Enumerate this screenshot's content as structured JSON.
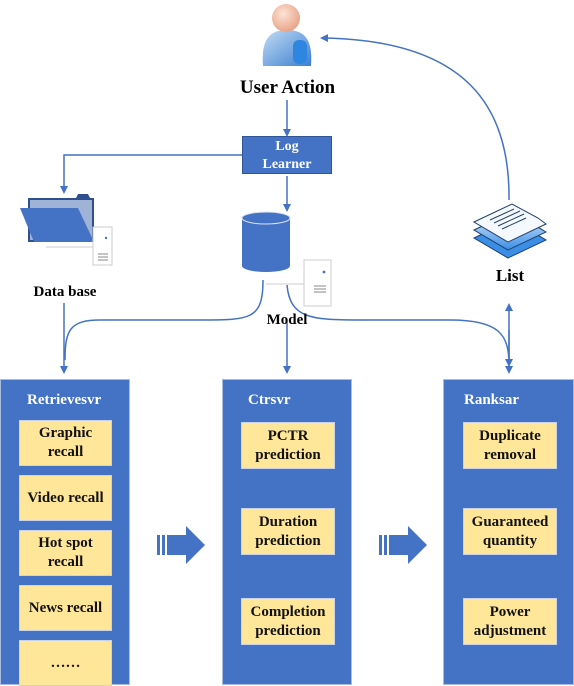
{
  "nodes": {
    "user_action": {
      "label": "User Action",
      "icon": "user-icon"
    },
    "log_learner": {
      "label_line1": "Log",
      "label_line2": "Learner"
    },
    "data_base": {
      "label": "Data base",
      "icon": "folder-icon"
    },
    "model": {
      "label": "Model",
      "icon": "database-cylinder-icon"
    },
    "list": {
      "label": "List",
      "icon": "document-stack-icon"
    }
  },
  "panels": {
    "retrieve": {
      "title": "Retrievesvr",
      "items": [
        "Graphic recall",
        "Video recall",
        "Hot spot recall",
        "News recall",
        "……"
      ]
    },
    "ctr": {
      "title": "Ctrsvr",
      "items": [
        "PCTR prediction",
        "Duration prediction",
        "Completion prediction"
      ]
    },
    "rank": {
      "title": "Ranksar",
      "items": [
        "Duplicate removal",
        "Guaranteed quantity",
        "Power adjustment"
      ]
    }
  },
  "colors": {
    "panel_blue": "#4472c4",
    "card_yellow": "#ffe699",
    "arrow_blue": "#4472c4"
  }
}
